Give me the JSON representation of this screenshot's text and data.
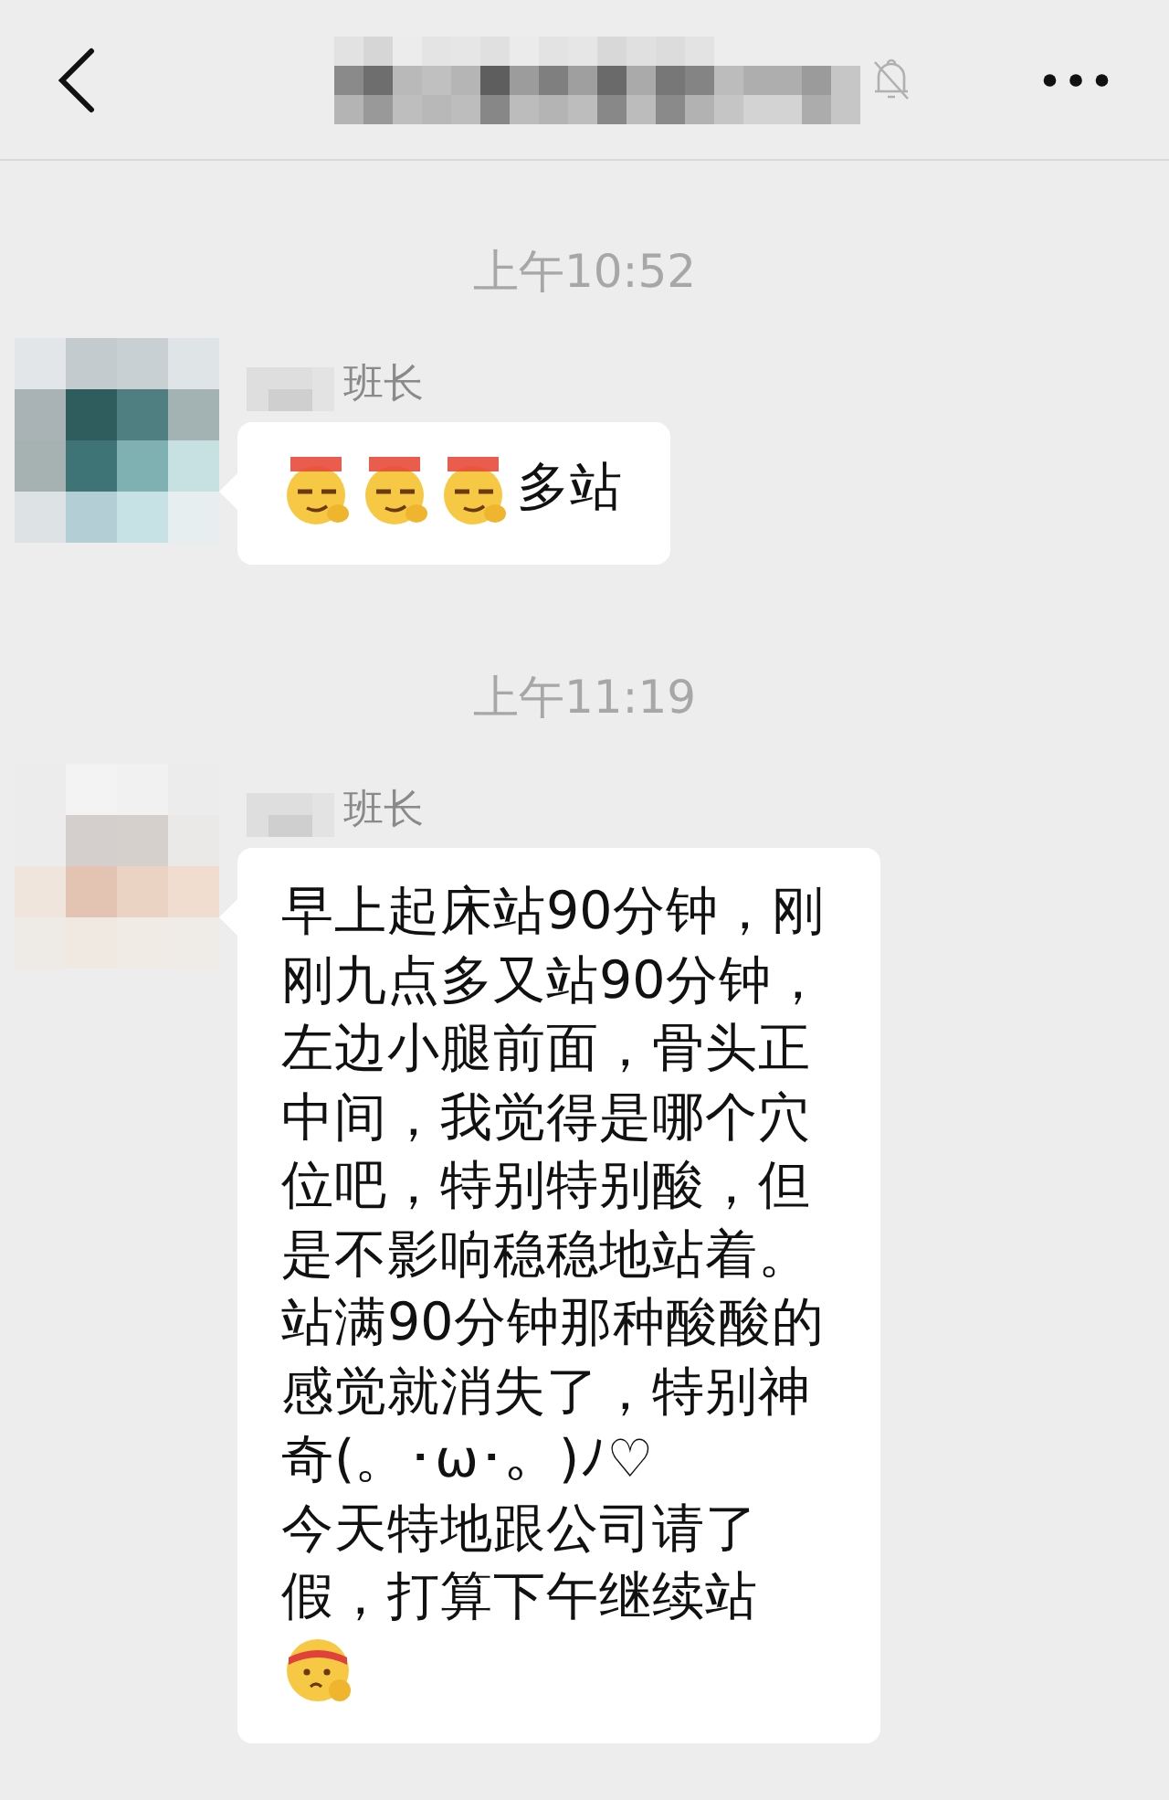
{
  "header": {
    "muted": true
  },
  "messages": [
    {
      "kind": "time",
      "text": "上午10:52"
    },
    {
      "kind": "message",
      "sender_suffix": "班长",
      "parts": [
        {
          "kind": "smirk"
        },
        {
          "kind": "smirk"
        },
        {
          "kind": "smirk"
        },
        {
          "kind": "text",
          "text": "多站"
        }
      ]
    },
    {
      "kind": "time",
      "text": "上午11:19"
    },
    {
      "kind": "message",
      "sender_suffix": "班长",
      "parts": [
        {
          "kind": "text",
          "text": "早上起床站90分钟，刚刚九点多又站90分钟，左边小腿前面，骨头正中间，我觉得是哪个穴位吧，特别特别酸，但是不影响稳稳地站着。站满90分钟那种酸酸的感觉就消失了，特别神奇(。･ω･。)ﾉ♡\n今天特地跟公司请了假，打算下午继续站"
        },
        {
          "kind": "headband"
        }
      ]
    }
  ]
}
